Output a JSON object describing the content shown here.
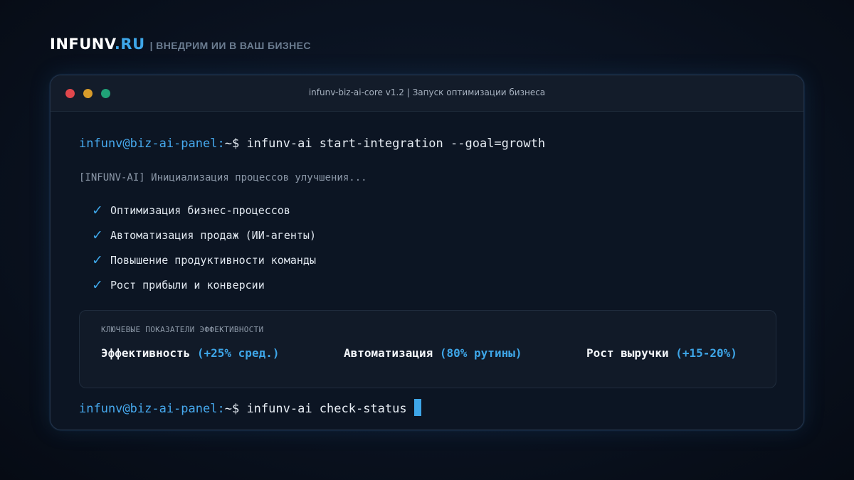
{
  "brand": {
    "name": "INFUNV",
    "tld": ".RU",
    "tagline": "| ВНЕДРИМ ИИ В ВАШ БИЗНЕС"
  },
  "window": {
    "title": "infunv-biz-ai-core v1.2 | Запуск оптимизации бизнеса"
  },
  "terminal": {
    "prompt_user": "infunv@biz-ai-panel:",
    "prompt_symbol": "~$",
    "command1": "infunv-ai start-integration --goal=growth",
    "log": "[INFUNV-AI] Инициализация процессов улучшения...",
    "checks": [
      "Оптимизация бизнес-процессов",
      "Автоматизация продаж (ИИ-агенты)",
      "Повышение продуктивности команды",
      "Рост прибыли и конверсии"
    ],
    "check_symbol": "✓",
    "command2": "infunv-ai check-status"
  },
  "kpi": {
    "heading": "КЛЮЧЕВЫЕ ПОКАЗАТЕЛИ ЭФФЕКТИВНОСТИ",
    "items": [
      {
        "label": "Эффективность",
        "value": "(+25% сред.)"
      },
      {
        "label": "Автоматизация",
        "value": "(80% рутины)"
      },
      {
        "label": "Рост выручки",
        "value": "(+15-20%)"
      }
    ]
  },
  "colors": {
    "accent": "#3ea6e8",
    "background": "#0a1220",
    "dot_red": "#e0474c",
    "dot_yellow": "#d79b2a",
    "dot_green": "#20a277"
  }
}
